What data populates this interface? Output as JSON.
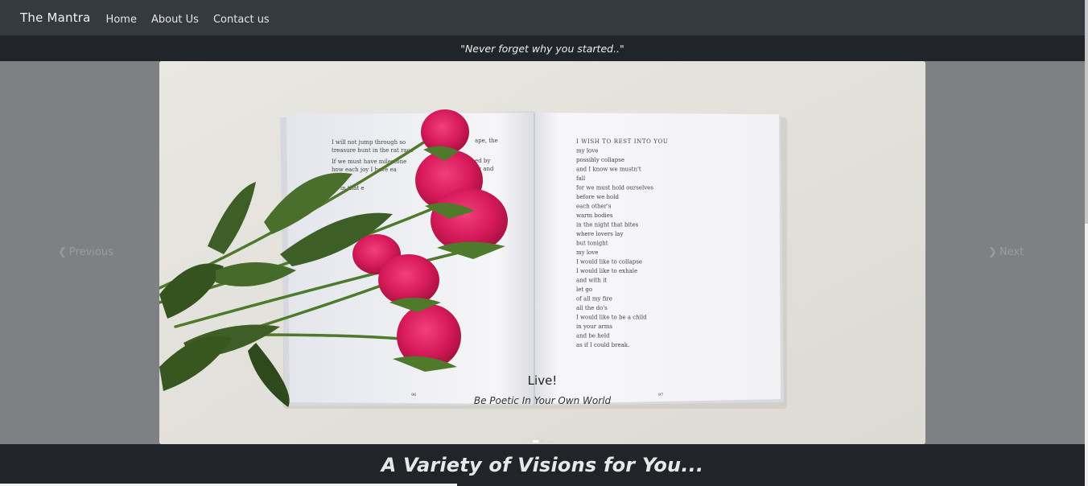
{
  "navbar": {
    "brand": "The Mantra",
    "links": [
      "Home",
      "About Us",
      "Contact us"
    ]
  },
  "quote": "\"Never forget why you started..\"",
  "carousel": {
    "caption_title": "Live!",
    "caption_subtitle": "Be Poetic In Your Own World",
    "prev_label": "Previous",
    "next_label": "Next",
    "indicators": 3,
    "active_index": 0
  },
  "book": {
    "left_lines": [
      "I will not jump through so",
      "treasure hunt in the rat race",
      "If we must have milestone",
      "how each joy I have ea",
      "",
      "be in that e"
    ],
    "left_right_fragments": [
      "ape, the",
      "",
      "ed by",
      "ay and"
    ],
    "right_title": "I WISH TO REST INTO YOU",
    "right_lines": [
      "my love",
      "possibly collapse",
      "and I know we mustn't",
      "fall",
      "for we must hold ourselves",
      "before we hold",
      "each other's",
      "warm bodies",
      "in the night that bites",
      "where lovers lay",
      "but tonight",
      "my love",
      "I would like to collapse",
      "I would like to exhale",
      "and with it",
      "let go",
      "of all my fire",
      "all the do's",
      "I would like to be a child",
      "in your arms",
      "and be held",
      "as if I could break."
    ],
    "page_numbers": [
      "96",
      "97"
    ]
  },
  "section": {
    "title": "A Variety of Visions for You..."
  }
}
